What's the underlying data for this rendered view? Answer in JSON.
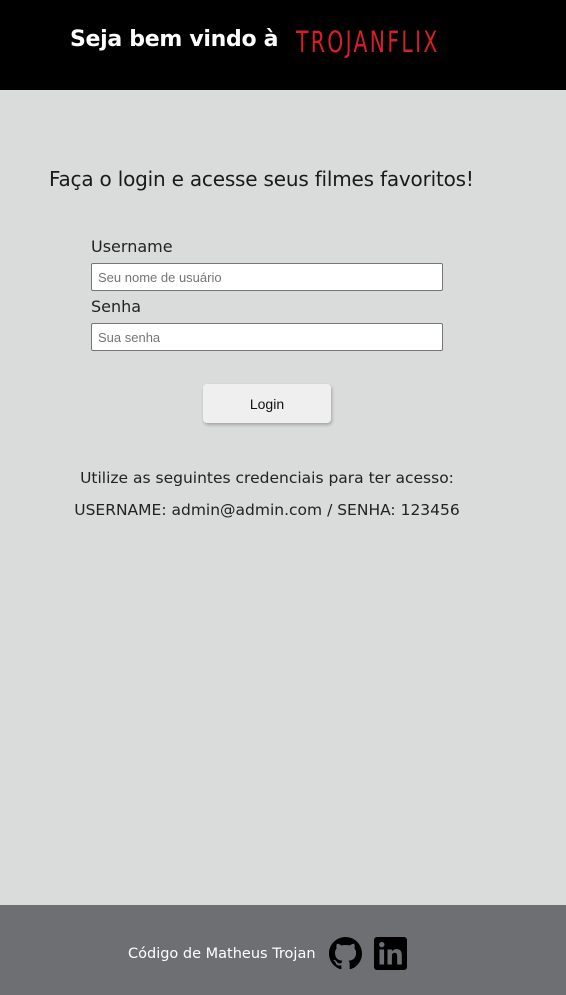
{
  "header": {
    "welcome": "Seja bem vindo à",
    "brand": "TROJANFLIX"
  },
  "main": {
    "headline": "Faça o login e acesse seus filmes favoritos!",
    "username_label": "Username",
    "username_placeholder": "Seu nome de usuário",
    "password_label": "Senha",
    "password_placeholder": "Sua senha",
    "login_button": "Login",
    "info_line1": "Utilize as seguintes credenciais para ter acesso:",
    "info_line2": "USERNAME: admin@admin.com / SENHA: 123456"
  },
  "footer": {
    "credit": "Código de Matheus Trojan",
    "icons": [
      "github-icon",
      "linkedin-icon"
    ]
  },
  "colors": {
    "header_bg": "#000000",
    "brand": "#d71f26",
    "page_bg": "#dadcdb",
    "footer_bg": "#6d6f73"
  }
}
